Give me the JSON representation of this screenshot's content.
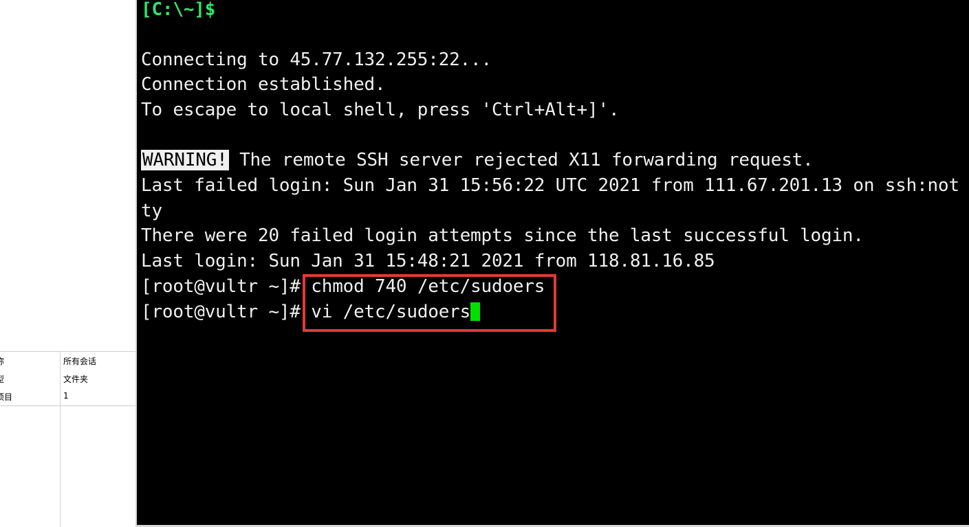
{
  "properties_panel": {
    "rows": [
      {
        "key": "称",
        "value": "所有会话"
      },
      {
        "key": "型",
        "value": "文件夹"
      },
      {
        "key": "项目",
        "value": "1"
      }
    ]
  },
  "terminal": {
    "local_prompt": "[C:\\~]$",
    "lines": [
      "Connecting to 45.77.132.255:22...",
      "Connection established.",
      "To escape to local shell, press 'Ctrl+Alt+]'."
    ],
    "warning_label": "WARNING!",
    "warning_text": " The remote SSH server rejected X11 forwarding request.",
    "last_failed_line1": "Last failed login: Sun Jan 31 15:56:22 UTC 2021 from 111.67.201.13 on ssh:not",
    "last_failed_line2": "ty",
    "failed_attempts": "There were 20 failed login attempts since the last successful login.",
    "last_login": "Last login: Sun Jan 31 15:48:21 2021 from 118.81.16.85",
    "remote_prompt": "[root@vultr ~]#",
    "command1": "chmod 740 /etc/sudoers",
    "command2": "vi /etc/sudoers"
  },
  "colors": {
    "terminal_bg": "#000000",
    "terminal_fg": "#f0f0f0",
    "local_prompt": "#2ee66b",
    "cursor": "#00e000",
    "highlight_border": "#e53935"
  }
}
